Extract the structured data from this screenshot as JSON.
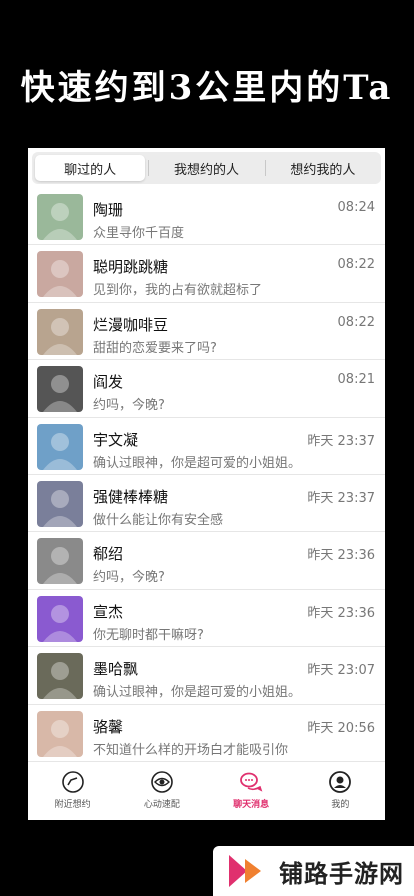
{
  "headline": "快速约到3公里内的Ta",
  "tabs": [
    {
      "label": "聊过的人",
      "active": true
    },
    {
      "label": "我想约的人",
      "active": false
    },
    {
      "label": "想约我的人",
      "active": false
    }
  ],
  "conversations": [
    {
      "name": "陶珊",
      "message": "众里寻你千百度",
      "time": "08:24",
      "avatar_color": "#9ab89a"
    },
    {
      "name": "聪明跳跳糖",
      "message": "见到你，我的占有欲就超标了",
      "time": "08:22",
      "avatar_color": "#c9a8a0"
    },
    {
      "name": "烂漫咖啡豆",
      "message": "甜甜的恋爱要来了吗?",
      "time": "08:22",
      "avatar_color": "#b8a48f"
    },
    {
      "name": "阎发",
      "message": "约吗，今晚?",
      "time": "08:21",
      "avatar_color": "#555555"
    },
    {
      "name": "宇文凝",
      "message": "确认过眼神，你是超可爱的小姐姐。",
      "time": "昨天 23:37",
      "avatar_color": "#6fa0c8"
    },
    {
      "name": "强健棒棒糖",
      "message": "做什么能让你有安全感",
      "time": "昨天 23:37",
      "avatar_color": "#7a7f9a"
    },
    {
      "name": "郗绍",
      "message": "约吗，今晚?",
      "time": "昨天 23:36",
      "avatar_color": "#8a8a8a"
    },
    {
      "name": "宣杰",
      "message": "你无聊时都干嘛呀?",
      "time": "昨天 23:36",
      "avatar_color": "#8a5ad0"
    },
    {
      "name": "墨哈飘",
      "message": "确认过眼神，你是超可爱的小姐姐。",
      "time": "昨天 23:07",
      "avatar_color": "#6a6a5a"
    },
    {
      "name": "骆馨",
      "message": "不知道什么样的开场白才能吸引你",
      "time": "昨天 20:56",
      "avatar_color": "#d8b8a8"
    }
  ],
  "tabbar": [
    {
      "label": "附近想约",
      "icon": "compass-icon",
      "active": false
    },
    {
      "label": "心动速配",
      "icon": "eye-icon",
      "active": false
    },
    {
      "label": "聊天消息",
      "icon": "chat-bubbles-icon",
      "active": true
    },
    {
      "label": "我的",
      "icon": "profile-icon",
      "active": false
    }
  ],
  "watermark": {
    "text": "铺路手游网",
    "accent": "#e0306e"
  }
}
